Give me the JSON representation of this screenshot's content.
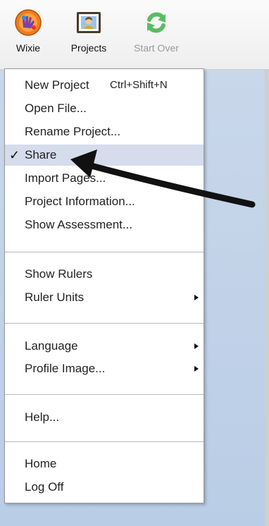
{
  "toolbar": {
    "wixie_label": "Wixie",
    "projects_label": "Projects",
    "startover_label": "Start Over"
  },
  "menu": {
    "new_project": {
      "label": "New Project",
      "shortcut": "Ctrl+Shift+N"
    },
    "open_file": "Open File...",
    "rename_project": "Rename Project...",
    "share": {
      "label": "Share",
      "check": "✓"
    },
    "import_pages": "Import Pages...",
    "project_information": "Project Information...",
    "show_assessment": "Show Assessment...",
    "show_rulers": "Show Rulers",
    "ruler_units": "Ruler Units",
    "language": "Language",
    "profile_image": "Profile Image...",
    "help": "Help...",
    "home": "Home",
    "log_off": "Log Off"
  },
  "colors": {
    "highlight": "#d5dceb",
    "workspace": "#bfd2e8",
    "annotation_arrow": "#111111"
  }
}
